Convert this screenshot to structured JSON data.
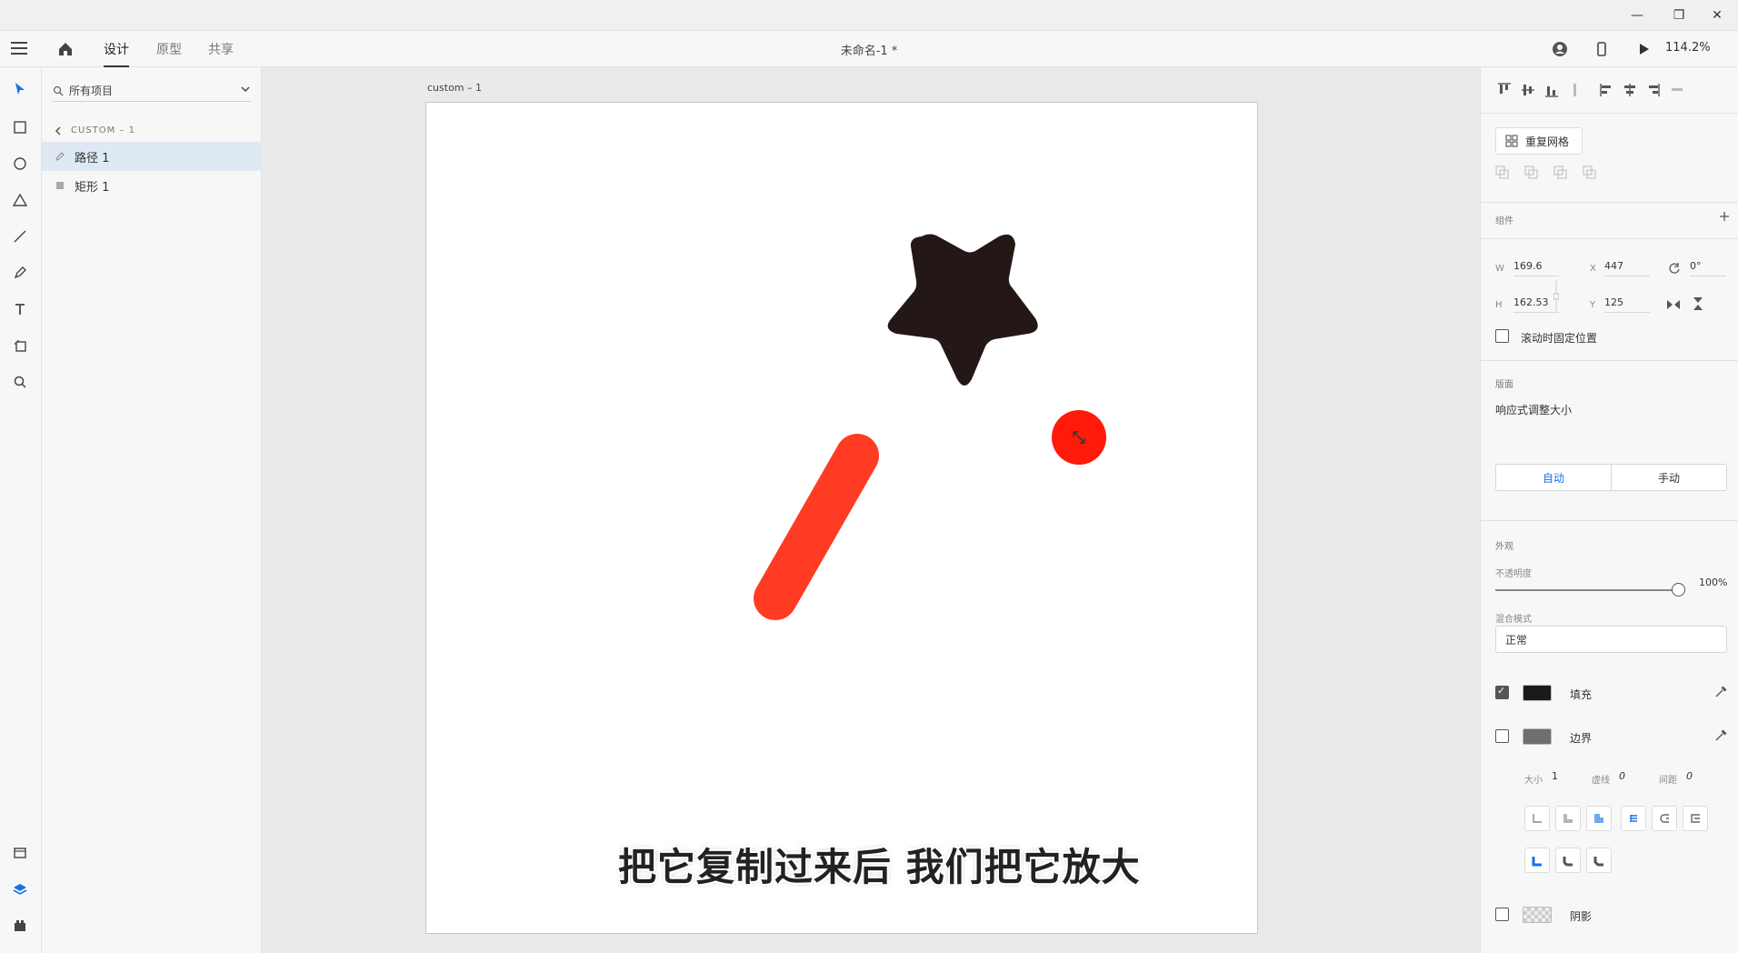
{
  "window": {
    "minimize": "—",
    "restore": "❐",
    "close": "✕"
  },
  "header": {
    "tabs": [
      {
        "label": "设计"
      },
      {
        "label": "原型"
      },
      {
        "label": "共享"
      }
    ],
    "doc_title": "未命名-1 *",
    "zoom": "114.2%"
  },
  "layers": {
    "filter_label": "所有项目",
    "breadcrumb": "CUSTOM – 1",
    "items": [
      {
        "label": "路径 1"
      },
      {
        "label": "矩形 1"
      }
    ]
  },
  "canvas": {
    "artboard_label": "custom – 1",
    "subtitle": "把它复制过来后 我们把它放大",
    "colors": {
      "star": "#231815",
      "bar": "#ff3b23",
      "dot": "#ff1a0a"
    }
  },
  "props": {
    "repeat_grid_label": "重复网格",
    "component_title": "组件",
    "w_label": "W",
    "w_value": "169.6",
    "h_label": "H",
    "h_value": "162.53",
    "x_label": "X",
    "x_value": "447",
    "y_label": "Y",
    "y_value": "125",
    "rotation_value": "0°",
    "fix_scroll_label": "滚动时固定位置",
    "layout_title": "版面",
    "responsive_label": "响应式调整大小",
    "seg_auto": "自动",
    "seg_manual": "手动",
    "appearance_title": "外观",
    "opacity_label": "不透明度",
    "opacity_value": "100%",
    "blend_label": "混合模式",
    "blend_value": "正常",
    "fill_label": "填充",
    "border_label": "边界",
    "size_label": "大小",
    "size_value": "1",
    "dash_label": "虚线",
    "dash_value": "0",
    "gap_label": "间距",
    "gap_value": "0",
    "shadow_label": "阴影",
    "fill_color": "#1a1a1a",
    "border_color": "#6f6f6f"
  }
}
